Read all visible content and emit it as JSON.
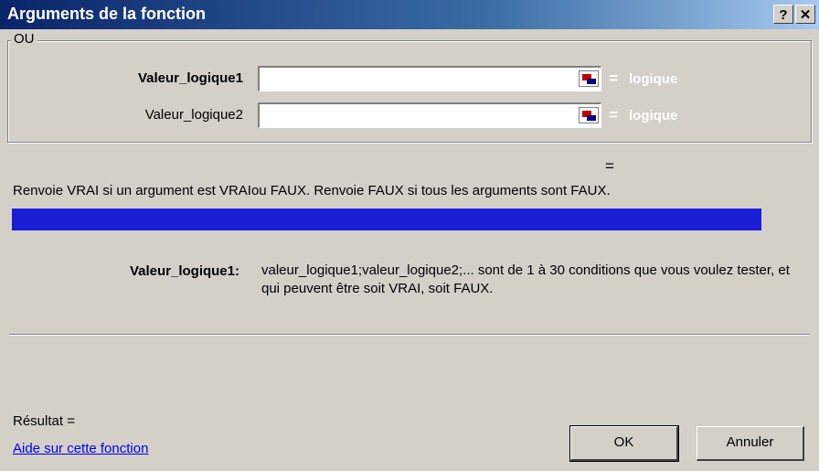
{
  "window": {
    "title": "Arguments de la fonction",
    "help_btn": "?",
    "close_btn": "✕"
  },
  "group": {
    "label": "OU",
    "args": [
      {
        "label": "Valeur_logique1",
        "value": "",
        "eq": "=",
        "type": "logique"
      },
      {
        "label": "Valeur_logique2",
        "value": "",
        "eq": "=",
        "type": "logique"
      }
    ]
  },
  "result_eq": "=",
  "description": "Renvoie VRAI si un argument est VRAIou FAUX. Renvoie FAUX si tous les arguments sont FAUX.",
  "help": {
    "arg_title": "Valeur_logique1:",
    "text": "valeur_logique1;valeur_logique2;... sont de 1 à 30 conditions que vous voulez tester, et qui peuvent être soit VRAI, soit FAUX."
  },
  "footer": {
    "result_label": "Résultat =",
    "help_link": "Aide sur cette fonction",
    "ok_label": "OK",
    "cancel_label": "Annuler"
  },
  "colors": {
    "titlebar_start": "#0a246a",
    "titlebar_end": "#a6caf0",
    "dialog_bg": "#d4d0c8",
    "highlight_bar": "#1a1ed6"
  }
}
